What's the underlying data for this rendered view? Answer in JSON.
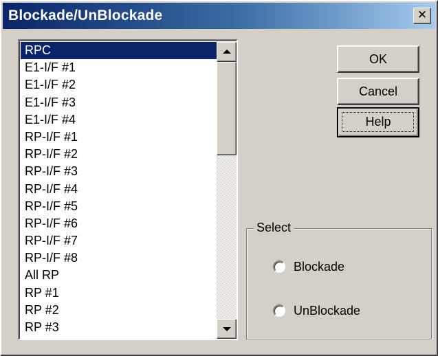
{
  "window": {
    "title": "Blockade/UnBlockade",
    "close_label": "✕"
  },
  "list": {
    "selected_index": 0,
    "items": [
      "RPC",
      "E1-I/F #1",
      "E1-I/F #2",
      "E1-I/F #3",
      "E1-I/F #4",
      "RP-I/F #1",
      "RP-I/F #2",
      "RP-I/F #3",
      "RP-I/F #4",
      "RP-I/F #5",
      "RP-I/F #6",
      "RP-I/F #7",
      "RP-I/F #8",
      "All RP",
      "RP #1",
      "RP #2",
      "RP #3"
    ]
  },
  "buttons": {
    "ok": "OK",
    "cancel": "Cancel",
    "help": "Help"
  },
  "select_group": {
    "legend": "Select",
    "options": [
      {
        "label": "Blockade",
        "checked": false
      },
      {
        "label": "UnBlockade",
        "checked": false
      }
    ]
  },
  "icons": {
    "close": "close-icon",
    "scroll_up": "arrow-up-icon",
    "scroll_down": "arrow-down-icon"
  },
  "colors": {
    "title_start": "#0a246a",
    "title_end": "#a6caf0",
    "selection": "#0a246a",
    "face": "#d4d0c8"
  }
}
